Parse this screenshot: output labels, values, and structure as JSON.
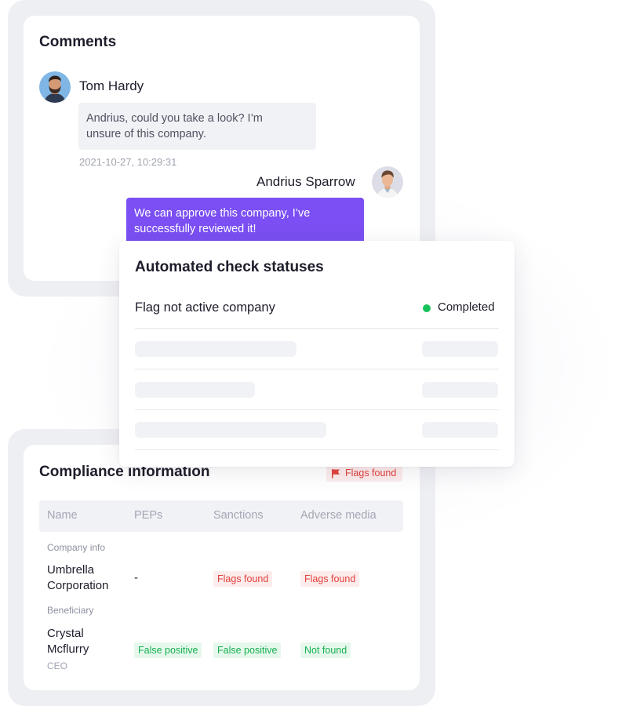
{
  "comments": {
    "title": "Comments",
    "messages": [
      {
        "author": "Tom Hardy",
        "text_line1": "Andrius, could you take a look? I’m",
        "text_line2": "unsure of this company.",
        "timestamp": "2021-10-27, 10:29:31"
      },
      {
        "author": "Andrius Sparrow",
        "text_line1": "We can approve this company, I’ve",
        "text_line2": "successfully reviewed it!"
      }
    ]
  },
  "automated": {
    "title": "Automated check statuses",
    "rows": [
      {
        "label": "Flag not active company",
        "status": "Completed",
        "status_color": "#16c25a"
      }
    ]
  },
  "compliance": {
    "title": "Compliance information",
    "badge": "Flags found",
    "columns": [
      "Name",
      "PEPs",
      "Sanctions",
      "Adverse media"
    ],
    "sections": [
      {
        "label": "Company info",
        "entity_line1": "Umbrella",
        "entity_line2": "Corporation",
        "peps": "-",
        "sanctions": "Flags found",
        "adverse_media": "Flags found"
      },
      {
        "label": "Beneficiary",
        "entity_line1": "Crystal",
        "entity_line2": "Mcflurry",
        "role": "CEO",
        "peps": "False positive",
        "sanctions": "False positive",
        "adverse_media": "Not found"
      }
    ]
  },
  "colors": {
    "accent_purple": "#7b4ff3",
    "flag_red": "#e2403b",
    "success_green": "#16c25a"
  }
}
